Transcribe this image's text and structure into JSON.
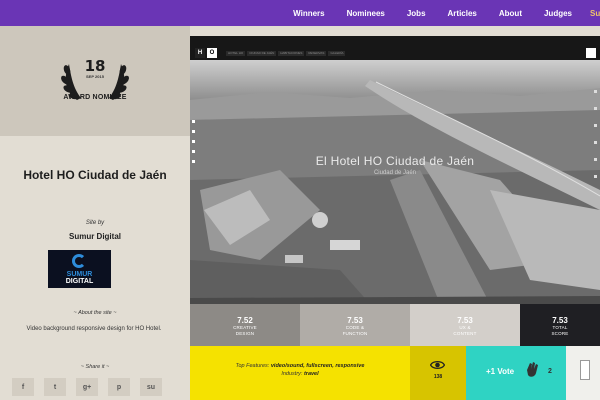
{
  "nav": {
    "items": [
      "Winners",
      "Nominees",
      "Jobs",
      "Articles",
      "About",
      "Judges",
      "Su"
    ]
  },
  "badge": {
    "number": "18",
    "date": "SEP 2015",
    "label": "AWARD NOMINEE"
  },
  "site": {
    "title": "Hotel HO Ciudad de Jaén",
    "by_label": "Site by",
    "author": "Sumur Digital",
    "author_logo_line1": "SUMUR",
    "author_logo_line2": "DIGITAL",
    "about_title": "~ About the site ~",
    "about_text": "Video background responsive design for HO Hotel.",
    "share_title": "~ Share it ~",
    "share_buttons": [
      {
        "icon": "facebook-icon",
        "glyph": "f"
      },
      {
        "icon": "twitter-icon",
        "glyph": "t"
      },
      {
        "icon": "googleplus-icon",
        "glyph": "g+"
      },
      {
        "icon": "pinterest-icon",
        "glyph": "p"
      },
      {
        "icon": "stumbleupon-icon",
        "glyph": "su"
      }
    ]
  },
  "frame": {
    "logo_h": "H",
    "logo_o": "O",
    "tabs": [
      "HOTEL HO",
      "CIUDAD DE JAÉN",
      "HABITACIONES",
      "RESERVAS",
      "GALERÍA"
    ],
    "video_title": "El Hotel HO Ciudad de Jaén",
    "video_subtitle": "Ciudad de Jaén"
  },
  "scores": [
    {
      "value": "7.52",
      "label": "CREATIVE\nDESIGN",
      "bg": "#8d8a86"
    },
    {
      "value": "7.53",
      "label": "CODE &\nFUNCTION",
      "bg": "#b0aca7"
    },
    {
      "value": "7.53",
      "label": "UX &\nCONTENT",
      "bg": "#d3cfca"
    },
    {
      "value": "7.53",
      "label": "TOTAL\nSCORE",
      "bg": "#1f1f23"
    }
  ],
  "features": {
    "prefix": "Top Features: ",
    "list": "video/sound, fullscreen, responsive",
    "industry_prefix": "Industry: ",
    "industry": "travel"
  },
  "views": {
    "count": "138",
    "icon": "eye-icon"
  },
  "vote": {
    "label": "+1 Vote",
    "count": "2",
    "icon": "clap-icon"
  },
  "colors": {
    "nav": "#6a35b5",
    "yellow": "#f5e200",
    "teal": "#2fd3c3"
  }
}
